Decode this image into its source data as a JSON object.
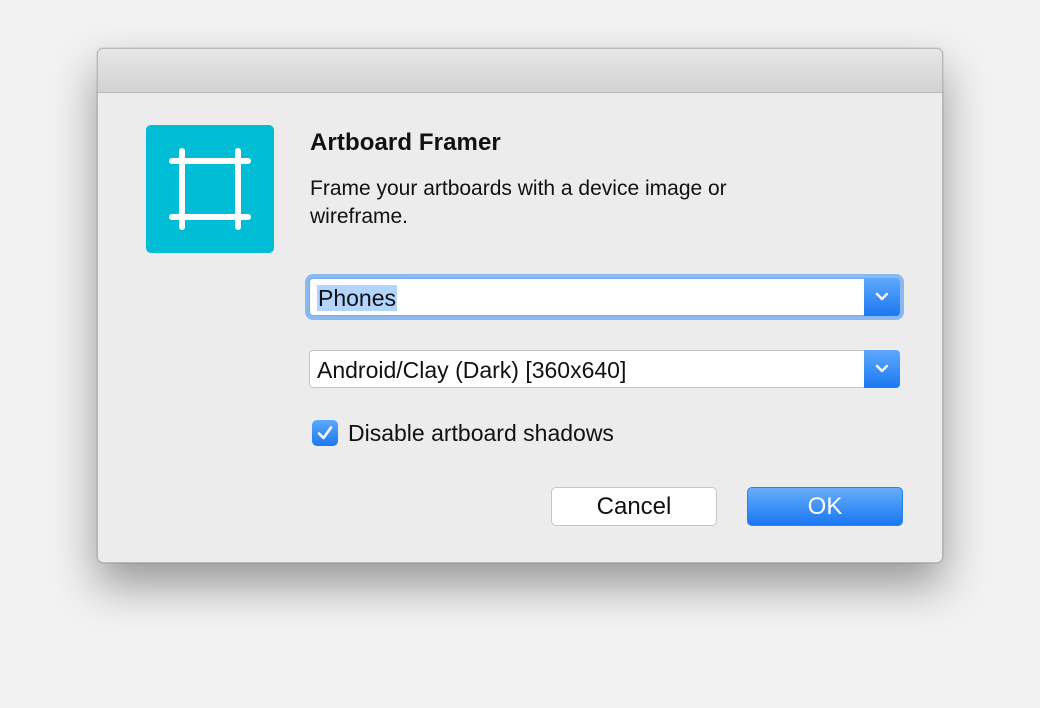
{
  "dialog": {
    "title": "Artboard Framer",
    "description": "Frame your artboards with a device image or wireframe.",
    "icon": "artboard-frame-icon",
    "accent": "#00bcd4"
  },
  "category_select": {
    "value": "Phones",
    "selected": true
  },
  "device_select": {
    "value": "Android/Clay (Dark) [360x640]"
  },
  "shadows_checkbox": {
    "label": "Disable artboard shadows",
    "checked": true
  },
  "buttons": {
    "cancel_label": "Cancel",
    "ok_label": "OK",
    "primary_color": "#1f7bf3"
  }
}
